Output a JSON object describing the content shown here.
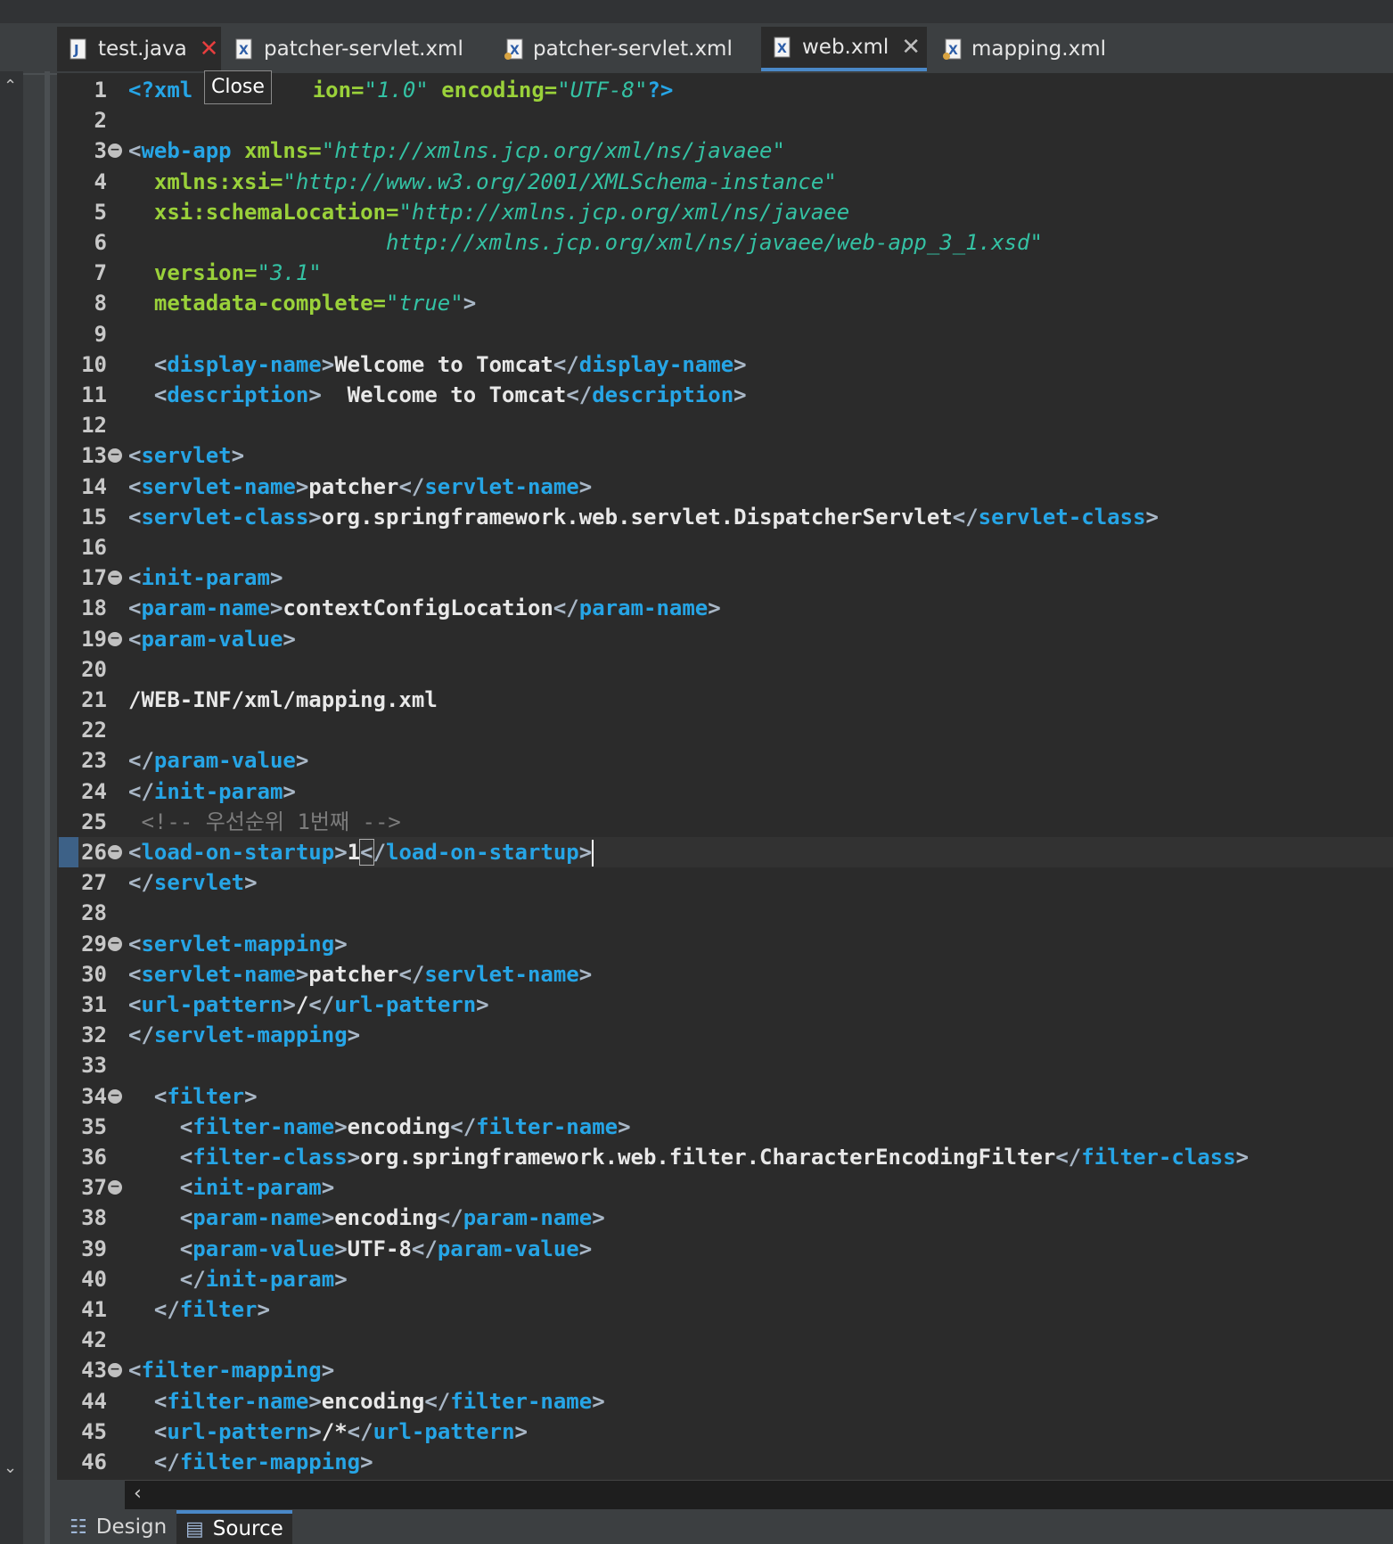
{
  "tabs": [
    {
      "label": "test.java",
      "icon": "java-file-icon"
    },
    {
      "label": "patcher-servlet.xml",
      "icon": "xml-file-icon"
    },
    {
      "label": "patcher-servlet.xml",
      "icon": "xml-file-icon"
    },
    {
      "label": "web.xml",
      "icon": "xml-file-icon"
    },
    {
      "label": "mapping.xml",
      "icon": "xml-file-icon"
    }
  ],
  "tooltip": "Close",
  "bottom_tabs": [
    {
      "label": "Design"
    },
    {
      "label": "Source"
    }
  ],
  "lines": [
    {
      "n": "1",
      "segs": [
        [
          "t",
          "<?xml "
        ],
        [
          "h",
          " "
        ],
        [
          "a",
          "ion="
        ],
        [
          "v",
          "\"1.0\""
        ],
        [
          "x",
          " "
        ],
        [
          "a",
          "encoding="
        ],
        [
          "v",
          "\"UTF-8\""
        ],
        [
          "t",
          "?>"
        ]
      ]
    },
    {
      "n": "2",
      "segs": []
    },
    {
      "n": "3",
      "fold": true,
      "segs": [
        [
          "p",
          "<"
        ],
        [
          "t",
          "web-app"
        ],
        [
          "x",
          " "
        ],
        [
          "a",
          "xmlns="
        ],
        [
          "v",
          "\"http://xmlns.jcp.org/xml/ns/javaee\""
        ]
      ]
    },
    {
      "n": "4",
      "segs": [
        [
          "x",
          "  "
        ],
        [
          "a",
          "xmlns:xsi="
        ],
        [
          "v",
          "\"http://www.w3.org/2001/XMLSchema-instance\""
        ]
      ]
    },
    {
      "n": "5",
      "segs": [
        [
          "x",
          "  "
        ],
        [
          "a",
          "xsi:schemaLocation="
        ],
        [
          "v",
          "\"http://xmlns.jcp.org/xml/ns/javaee"
        ]
      ]
    },
    {
      "n": "6",
      "segs": [
        [
          "x",
          "                    "
        ],
        [
          "v",
          "http://xmlns.jcp.org/xml/ns/javaee/web-app_3_1.xsd\""
        ]
      ]
    },
    {
      "n": "7",
      "segs": [
        [
          "x",
          "  "
        ],
        [
          "a",
          "version="
        ],
        [
          "v",
          "\"3.1\""
        ]
      ]
    },
    {
      "n": "8",
      "segs": [
        [
          "x",
          "  "
        ],
        [
          "a",
          "metadata-complete="
        ],
        [
          "v",
          "\"true\""
        ],
        [
          "p",
          ">"
        ]
      ]
    },
    {
      "n": "9",
      "segs": []
    },
    {
      "n": "10",
      "segs": [
        [
          "x",
          "  "
        ],
        [
          "p",
          "<"
        ],
        [
          "t",
          "display-name"
        ],
        [
          "p",
          ">"
        ],
        [
          "x",
          "Welcome to Tomcat"
        ],
        [
          "p",
          "</"
        ],
        [
          "t",
          "display-name"
        ],
        [
          "p",
          ">"
        ]
      ]
    },
    {
      "n": "11",
      "segs": [
        [
          "x",
          "  "
        ],
        [
          "p",
          "<"
        ],
        [
          "t",
          "description"
        ],
        [
          "p",
          ">"
        ],
        [
          "x",
          "  Welcome to Tomcat"
        ],
        [
          "p",
          "</"
        ],
        [
          "t",
          "description"
        ],
        [
          "p",
          ">"
        ]
      ]
    },
    {
      "n": "12",
      "segs": []
    },
    {
      "n": "13",
      "fold": true,
      "segs": [
        [
          "p",
          "<"
        ],
        [
          "t",
          "servlet"
        ],
        [
          "p",
          ">"
        ]
      ]
    },
    {
      "n": "14",
      "segs": [
        [
          "p",
          "<"
        ],
        [
          "t",
          "servlet-name"
        ],
        [
          "p",
          ">"
        ],
        [
          "x",
          "patcher"
        ],
        [
          "p",
          "</"
        ],
        [
          "t",
          "servlet-name"
        ],
        [
          "p",
          ">"
        ]
      ]
    },
    {
      "n": "15",
      "segs": [
        [
          "p",
          "<"
        ],
        [
          "t",
          "servlet-class"
        ],
        [
          "p",
          ">"
        ],
        [
          "x",
          "org.springframework.web.servlet.DispatcherServlet"
        ],
        [
          "p",
          "</"
        ],
        [
          "t",
          "servlet-class"
        ],
        [
          "p",
          ">"
        ]
      ]
    },
    {
      "n": "16",
      "segs": []
    },
    {
      "n": "17",
      "fold": true,
      "segs": [
        [
          "p",
          "<"
        ],
        [
          "t",
          "init-param"
        ],
        [
          "p",
          ">"
        ]
      ]
    },
    {
      "n": "18",
      "segs": [
        [
          "p",
          "<"
        ],
        [
          "t",
          "param-name"
        ],
        [
          "p",
          ">"
        ],
        [
          "x",
          "contextConfigLocation"
        ],
        [
          "p",
          "</"
        ],
        [
          "t",
          "param-name"
        ],
        [
          "p",
          ">"
        ]
      ]
    },
    {
      "n": "19",
      "fold": true,
      "segs": [
        [
          "p",
          "<"
        ],
        [
          "t",
          "param-value"
        ],
        [
          "p",
          ">"
        ]
      ]
    },
    {
      "n": "20",
      "segs": []
    },
    {
      "n": "21",
      "segs": [
        [
          "x",
          "/WEB-INF/xml/mapping.xml"
        ]
      ]
    },
    {
      "n": "22",
      "segs": []
    },
    {
      "n": "23",
      "segs": [
        [
          "p",
          "</"
        ],
        [
          "t",
          "param-value"
        ],
        [
          "p",
          ">"
        ]
      ]
    },
    {
      "n": "24",
      "segs": [
        [
          "p",
          "</"
        ],
        [
          "t",
          "init-param"
        ],
        [
          "p",
          ">"
        ]
      ]
    },
    {
      "n": "25",
      "segs": [
        [
          "c",
          " <!-- 우선순위 1번째 -->"
        ]
      ]
    },
    {
      "n": "26",
      "fold": true,
      "current": true,
      "segs": [
        [
          "p",
          "<"
        ],
        [
          "t",
          "load-on-startup"
        ],
        [
          "p",
          ">"
        ],
        [
          "x",
          "1"
        ],
        [
          "b",
          "<"
        ],
        [
          "p",
          "/"
        ],
        [
          "t",
          "load-on-startup"
        ],
        [
          "p",
          ">"
        ],
        [
          "caret",
          ""
        ]
      ]
    },
    {
      "n": "27",
      "segs": [
        [
          "p",
          "</"
        ],
        [
          "t",
          "servlet"
        ],
        [
          "p",
          ">"
        ]
      ]
    },
    {
      "n": "28",
      "segs": []
    },
    {
      "n": "29",
      "fold": true,
      "segs": [
        [
          "p",
          "<"
        ],
        [
          "t",
          "servlet-mapping"
        ],
        [
          "p",
          ">"
        ]
      ]
    },
    {
      "n": "30",
      "segs": [
        [
          "p",
          "<"
        ],
        [
          "t",
          "servlet-name"
        ],
        [
          "p",
          ">"
        ],
        [
          "x",
          "patcher"
        ],
        [
          "p",
          "</"
        ],
        [
          "t",
          "servlet-name"
        ],
        [
          "p",
          ">"
        ]
      ]
    },
    {
      "n": "31",
      "segs": [
        [
          "p",
          "<"
        ],
        [
          "t",
          "url-pattern"
        ],
        [
          "p",
          ">"
        ],
        [
          "x",
          "/"
        ],
        [
          "p",
          "</"
        ],
        [
          "t",
          "url-pattern"
        ],
        [
          "p",
          ">"
        ]
      ]
    },
    {
      "n": "32",
      "segs": [
        [
          "p",
          "</"
        ],
        [
          "t",
          "servlet-mapping"
        ],
        [
          "p",
          ">"
        ]
      ]
    },
    {
      "n": "33",
      "segs": []
    },
    {
      "n": "34",
      "fold": true,
      "segs": [
        [
          "x",
          "  "
        ],
        [
          "p",
          "<"
        ],
        [
          "t",
          "filter"
        ],
        [
          "p",
          ">"
        ]
      ]
    },
    {
      "n": "35",
      "segs": [
        [
          "x",
          "    "
        ],
        [
          "p",
          "<"
        ],
        [
          "t",
          "filter-name"
        ],
        [
          "p",
          ">"
        ],
        [
          "x",
          "encoding"
        ],
        [
          "p",
          "</"
        ],
        [
          "t",
          "filter-name"
        ],
        [
          "p",
          ">"
        ]
      ]
    },
    {
      "n": "36",
      "segs": [
        [
          "x",
          "    "
        ],
        [
          "p",
          "<"
        ],
        [
          "t",
          "filter-class"
        ],
        [
          "p",
          ">"
        ],
        [
          "x",
          "org.springframework.web.filter.CharacterEncodingFilter"
        ],
        [
          "p",
          "</"
        ],
        [
          "t",
          "filter-class"
        ],
        [
          "p",
          ">"
        ]
      ]
    },
    {
      "n": "37",
      "fold": true,
      "segs": [
        [
          "x",
          "    "
        ],
        [
          "p",
          "<"
        ],
        [
          "t",
          "init-param"
        ],
        [
          "p",
          ">"
        ]
      ]
    },
    {
      "n": "38",
      "segs": [
        [
          "x",
          "    "
        ],
        [
          "p",
          "<"
        ],
        [
          "t",
          "param-name"
        ],
        [
          "p",
          ">"
        ],
        [
          "x",
          "encoding"
        ],
        [
          "p",
          "</"
        ],
        [
          "t",
          "param-name"
        ],
        [
          "p",
          ">"
        ]
      ]
    },
    {
      "n": "39",
      "segs": [
        [
          "x",
          "    "
        ],
        [
          "p",
          "<"
        ],
        [
          "t",
          "param-value"
        ],
        [
          "p",
          ">"
        ],
        [
          "x",
          "UTF-8"
        ],
        [
          "p",
          "</"
        ],
        [
          "t",
          "param-value"
        ],
        [
          "p",
          ">"
        ]
      ]
    },
    {
      "n": "40",
      "segs": [
        [
          "x",
          "    "
        ],
        [
          "p",
          "</"
        ],
        [
          "t",
          "init-param"
        ],
        [
          "p",
          ">"
        ]
      ]
    },
    {
      "n": "41",
      "segs": [
        [
          "x",
          "  "
        ],
        [
          "p",
          "</"
        ],
        [
          "t",
          "filter"
        ],
        [
          "p",
          ">"
        ]
      ]
    },
    {
      "n": "42",
      "segs": []
    },
    {
      "n": "43",
      "fold": true,
      "segs": [
        [
          "p",
          "<"
        ],
        [
          "t",
          "filter-mapping"
        ],
        [
          "p",
          ">"
        ]
      ]
    },
    {
      "n": "44",
      "segs": [
        [
          "x",
          "  "
        ],
        [
          "p",
          "<"
        ],
        [
          "t",
          "filter-name"
        ],
        [
          "p",
          ">"
        ],
        [
          "x",
          "encoding"
        ],
        [
          "p",
          "</"
        ],
        [
          "t",
          "filter-name"
        ],
        [
          "p",
          ">"
        ]
      ]
    },
    {
      "n": "45",
      "segs": [
        [
          "x",
          "  "
        ],
        [
          "p",
          "<"
        ],
        [
          "t",
          "url-pattern"
        ],
        [
          "p",
          ">"
        ],
        [
          "x",
          "/*"
        ],
        [
          "p",
          "</"
        ],
        [
          "t",
          "url-pattern"
        ],
        [
          "p",
          ">"
        ]
      ]
    },
    {
      "n": "46",
      "segs": [
        [
          "x",
          "  "
        ],
        [
          "p",
          "</"
        ],
        [
          "t",
          "filter-mapping"
        ],
        [
          "p",
          ">"
        ]
      ]
    }
  ]
}
